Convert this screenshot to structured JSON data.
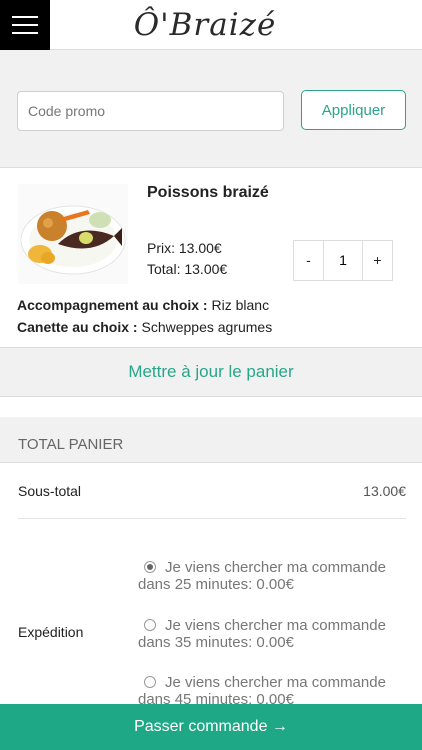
{
  "header": {
    "menu_icon": "hamburger-menu-icon",
    "logo_text": "Ô'Braizé"
  },
  "promo": {
    "placeholder": "Code promo",
    "value": "",
    "apply_label": "Appliquer"
  },
  "cart": {
    "item": {
      "name": "Poissons braizé",
      "image": "grilled-fish-plate-image",
      "price": "Prix: 13.00€",
      "total": "Total: 13.00€",
      "quantity": "1",
      "minus_label": "-",
      "plus_label": "+",
      "options": [
        {
          "label": "Accompagnement au choix :",
          "value": "Riz blanc"
        },
        {
          "label": "Canette au choix :",
          "value": "Schweppes agrumes"
        }
      ]
    },
    "update_label": "Mettre à jour le panier"
  },
  "totals": {
    "title": "TOTAL PANIER",
    "subtotal_label": "Sous-total",
    "subtotal_value": "13.00€",
    "shipping_label": "Expédition",
    "shipping_options": [
      {
        "text": "Je viens chercher ma commande dans 25 minutes: 0.00€",
        "checked": true
      },
      {
        "text": "Je viens chercher ma commande dans 35 minutes: 0.00€",
        "checked": false
      },
      {
        "text": "Je viens chercher ma commande dans 45 minutes: 0.00€",
        "checked": false
      }
    ]
  },
  "checkout_label": "Passer commande →",
  "colors": {
    "accent": "#2aa58a",
    "checkout_bg": "#1ea886",
    "panel_bg": "#f1f1f1"
  }
}
